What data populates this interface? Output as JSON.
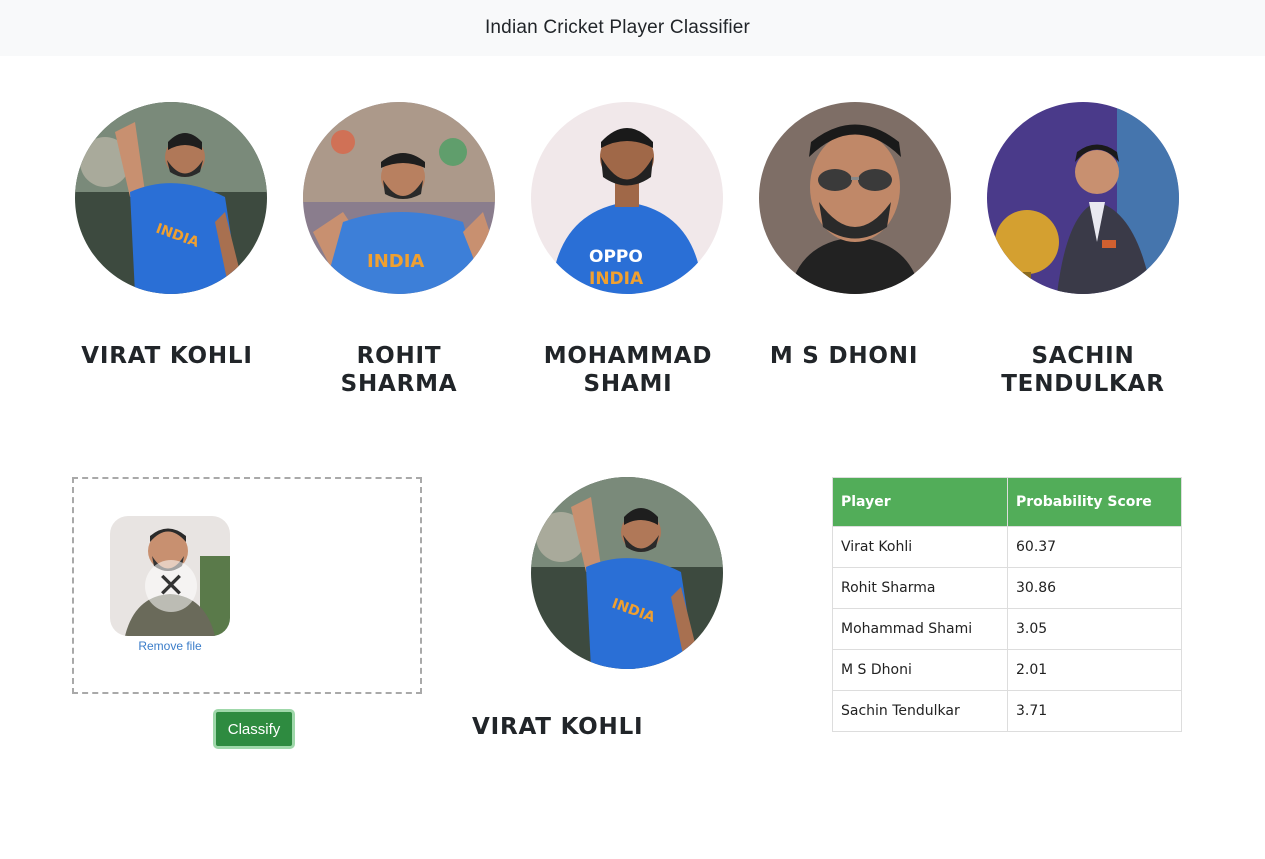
{
  "navbar": {
    "title": "Indian Cricket Player Classifier"
  },
  "players": [
    {
      "name_line1": "VIRAT KOHLI",
      "name_line2": ""
    },
    {
      "name_line1": "ROHIT",
      "name_line2": "SHARMA"
    },
    {
      "name_line1": "MOHAMMAD",
      "name_line2": "SHAMI"
    },
    {
      "name_line1": "M S DHONI",
      "name_line2": ""
    },
    {
      "name_line1": "SACHIN",
      "name_line2": "TENDULKAR"
    }
  ],
  "upload": {
    "remove_label": "Remove file",
    "remove_icon": "close-icon",
    "classify_label": "Classify"
  },
  "result": {
    "name": "VIRAT KOHLI"
  },
  "scores_table": {
    "headers": [
      "Player",
      "Probability Score"
    ],
    "rows": [
      [
        "Virat Kohli",
        "60.37"
      ],
      [
        "Rohit Sharma",
        "30.86"
      ],
      [
        "Mohammad Shami",
        "3.05"
      ],
      [
        "M S Dhoni",
        "2.01"
      ],
      [
        "Sachin Tendulkar",
        "3.71"
      ]
    ]
  },
  "colors": {
    "navbar_bg": "#f8f9fa",
    "table_header_bg": "#52ad59",
    "classify_button": "#2e8b40",
    "jersey_blue": "#2a6fd6"
  }
}
